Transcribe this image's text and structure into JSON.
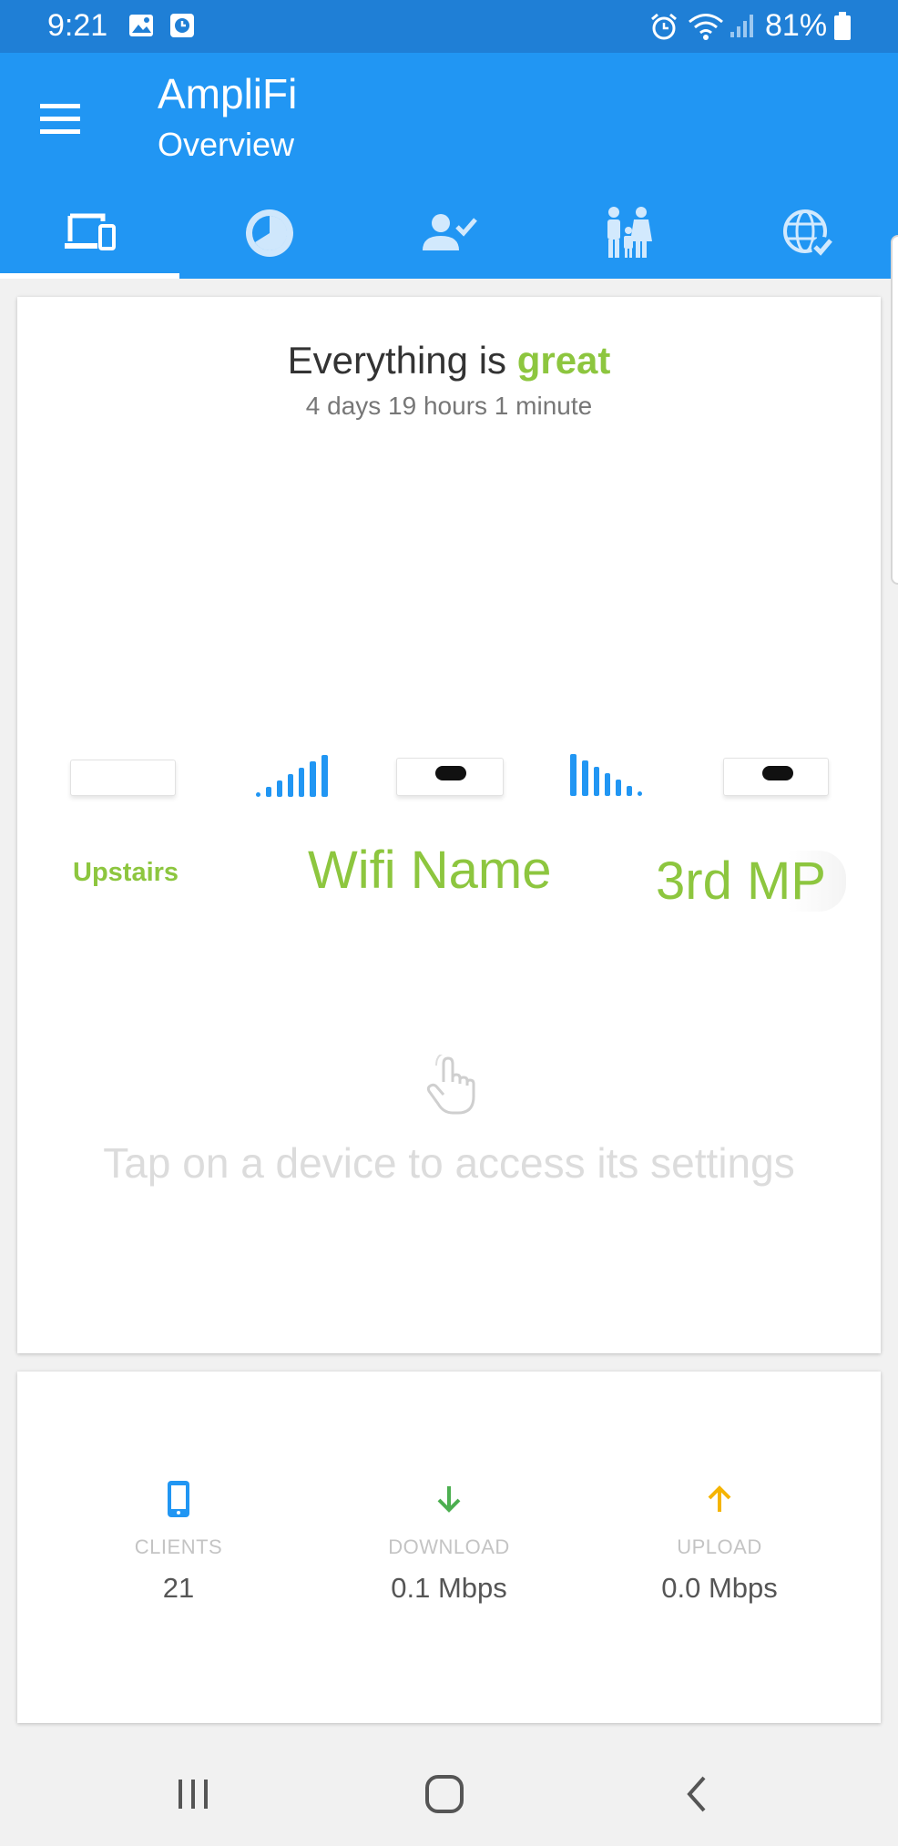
{
  "status_bar": {
    "time": "9:21",
    "battery": "81%",
    "icons": [
      "image-icon",
      "clock-app-icon",
      "alarm-icon",
      "wifi-icon",
      "signal-icon",
      "battery-icon"
    ]
  },
  "app_bar": {
    "title": "AmpliFi",
    "subtitle": "Overview",
    "tabs": [
      {
        "icon": "devices-icon",
        "selected": true
      },
      {
        "icon": "history-icon",
        "selected": false
      },
      {
        "icon": "guest-icon",
        "selected": false
      },
      {
        "icon": "family-icon",
        "selected": false
      },
      {
        "icon": "internet-icon",
        "selected": false
      }
    ]
  },
  "overview": {
    "status_prefix": "Everything is",
    "status_word": "great",
    "uptime": "4 days 19 hours 1 minute",
    "devices": [
      {
        "label": "Upstairs"
      },
      {
        "label": "Wifi Name"
      },
      {
        "label": "3rd MP"
      }
    ],
    "hint": "Tap on a device to access its settings"
  },
  "stats": [
    {
      "label": "CLIENTS",
      "value": "21",
      "icon": "phone-icon",
      "color": "#2196f3"
    },
    {
      "label": "DOWNLOAD",
      "value": "0.1 Mbps",
      "icon": "arrow-down-icon",
      "color": "#4caf50"
    },
    {
      "label": "UPLOAD",
      "value": "0.0 Mbps",
      "icon": "arrow-up-icon",
      "color": "#f5b400"
    }
  ],
  "colors": {
    "status_bar": "#1f7fd6",
    "app_bar": "#2196f3",
    "accent_green": "#8dc63f"
  }
}
